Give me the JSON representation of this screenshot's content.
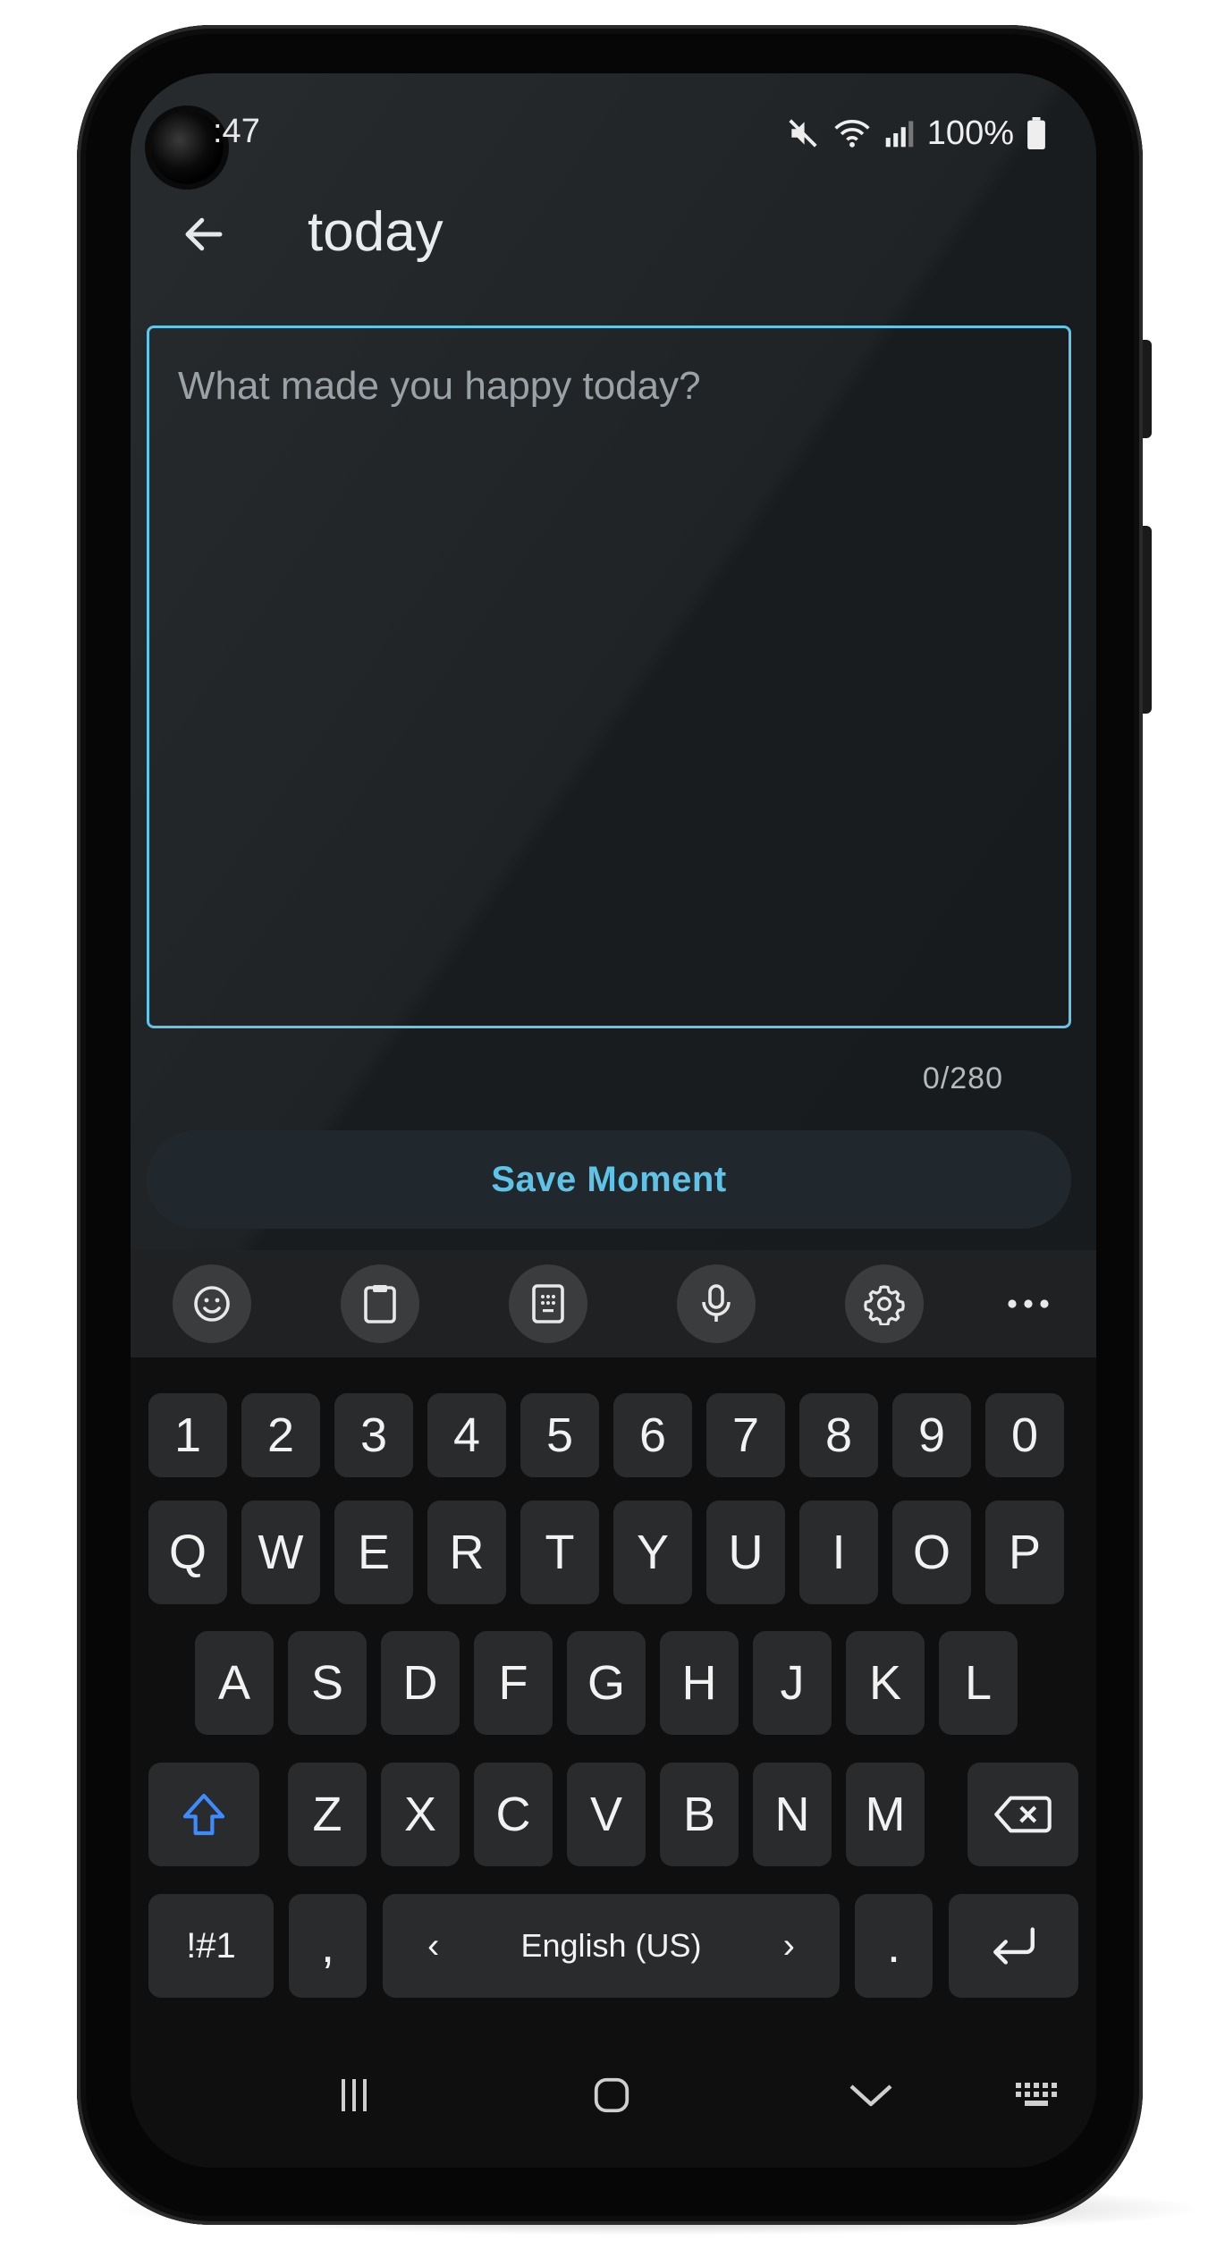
{
  "status_bar": {
    "time": ":47",
    "battery": "100%",
    "icons": [
      "mute-icon",
      "wifi-icon",
      "signal-icon",
      "battery-icon"
    ]
  },
  "app_bar": {
    "back_icon": "arrow-left-icon",
    "title": "today"
  },
  "entry": {
    "placeholder": "What made you happy today?",
    "value": "",
    "counter": "0/280"
  },
  "save_button": {
    "label": "Save Moment"
  },
  "keyboard": {
    "toolbar_icons": [
      "emoji-icon",
      "clipboard-icon",
      "keypad-icon",
      "mic-icon",
      "settings-icon",
      "more-icon"
    ],
    "number_row": [
      "1",
      "2",
      "3",
      "4",
      "5",
      "6",
      "7",
      "8",
      "9",
      "0"
    ],
    "row1": [
      "Q",
      "W",
      "E",
      "R",
      "T",
      "Y",
      "U",
      "I",
      "O",
      "P"
    ],
    "row2": [
      "A",
      "S",
      "D",
      "F",
      "G",
      "H",
      "J",
      "K",
      "L"
    ],
    "row3": [
      "Z",
      "X",
      "C",
      "V",
      "B",
      "N",
      "M"
    ],
    "symbols_key": "!#1",
    "comma_key": ",",
    "language": "English (US)",
    "period_key": "."
  },
  "colors": {
    "accent": "#5fc6e8",
    "background": "#1a1d1f",
    "key": "#2a2b2d",
    "shift_accent": "#3d8bfd"
  }
}
